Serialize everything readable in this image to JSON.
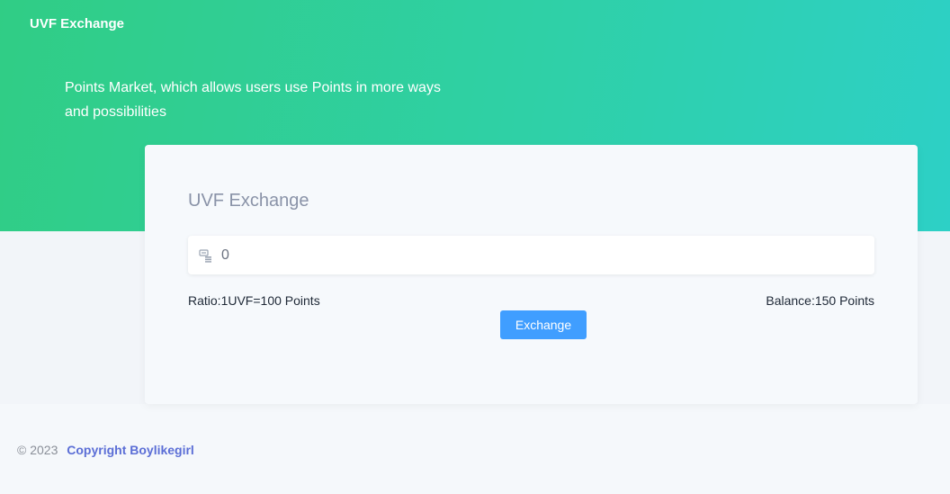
{
  "header": {
    "brand": "UVF Exchange",
    "description": "Points Market, which allows users use Points in more ways and possibilities"
  },
  "card": {
    "title": "UVF Exchange",
    "amount_value": "0",
    "amount_icon": "exchange-icon",
    "ratio": "Ratio:1UVF=100 Points",
    "balance": "Balance:150 Points",
    "exchange_label": "Exchange"
  },
  "footer": {
    "year": "© 2023",
    "copyright": "Copyright Boylikegirl"
  },
  "colors": {
    "gradient_start": "#30cd85",
    "gradient_end": "#2dd0c6",
    "button": "#409eff",
    "link": "#5b6ed6"
  }
}
